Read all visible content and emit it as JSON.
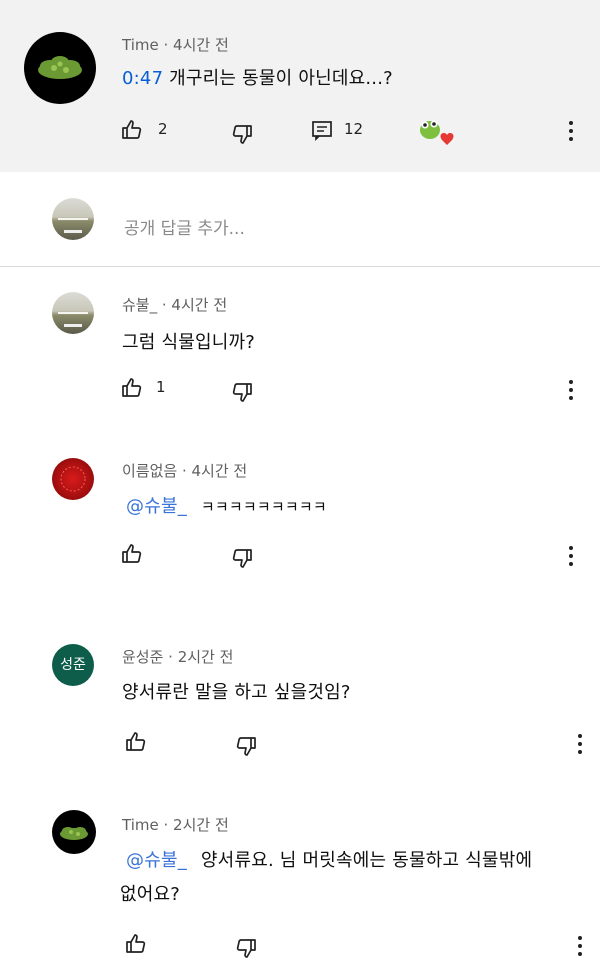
{
  "top_comment": {
    "author": "Time",
    "time": "4시간 전",
    "timestamp_link": "0:47",
    "text": " 개구리는 동물이 아닌데요...?",
    "likes": "2",
    "replies": "12"
  },
  "reply_input": {
    "placeholder": "공개 답글 추가..."
  },
  "replies": [
    {
      "author": "슈불_",
      "time": "4시간 전",
      "mention": "",
      "text": "그럼 식물입니까?",
      "likes": "1"
    },
    {
      "author": "이름없음",
      "time": "4시간 전",
      "mention": "@슈불_",
      "text": "ㅋㅋㅋㅋㅋㅋㅋㅋㅋ",
      "likes": ""
    },
    {
      "author": "윤성준",
      "time": "2시간 전",
      "avatar_text": "성준",
      "mention": "",
      "text": "양서류란 말을 하고 싶을것임?",
      "likes": ""
    },
    {
      "author": "Time",
      "time": "2시간 전",
      "mention": "@슈불_",
      "text": "양서류요. 님 머릿속에는 동물하고 식물밖에",
      "text2": "없어요?",
      "likes": ""
    }
  ],
  "separator": " · ",
  "colors": {
    "timestamp": "#065fd4",
    "mention": "#3a73d9",
    "highlight_bg": "#f2f2f2",
    "avatar_green": "#0d5d4a"
  }
}
